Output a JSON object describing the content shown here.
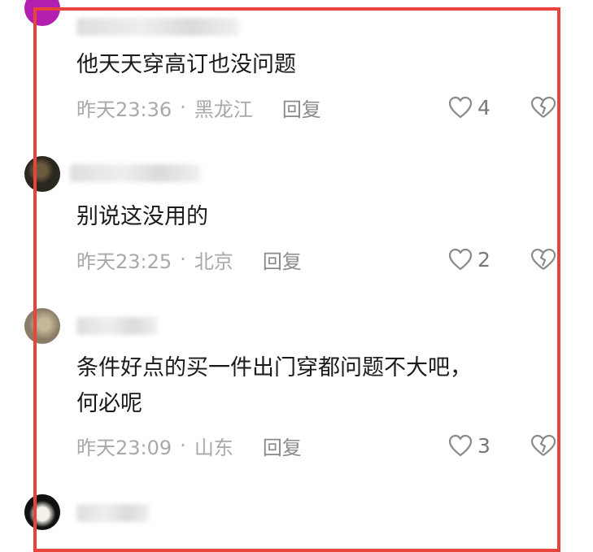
{
  "comments": [
    {
      "text": "他天天穿高订也没问题",
      "time": "昨天23:36",
      "separator": "·",
      "location": "黑龙江",
      "reply_label": "回复",
      "likes": "4",
      "avatar_color": "#b31fae"
    },
    {
      "text": "别说这没用的",
      "time": "昨天23:25",
      "separator": "·",
      "location": "北京",
      "reply_label": "回复",
      "likes": "2",
      "avatar_color": "#2a2620"
    },
    {
      "text_line1": "条件好点的买一件出门穿都问题不大吧，",
      "text_line2": "何必呢",
      "time": "昨天23:09",
      "separator": "·",
      "location": "山东",
      "reply_label": "回复",
      "likes": "3",
      "avatar_color": "#8a7c66"
    }
  ],
  "accent_border_color": "#e8443a"
}
